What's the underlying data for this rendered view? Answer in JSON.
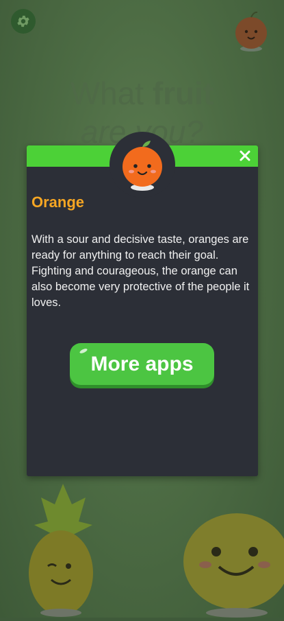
{
  "background": {
    "title_line1_normal": "What ",
    "title_line1_bold": "fruit",
    "title_line2": "are you?"
  },
  "icons": {
    "settings": "gear-icon",
    "close": "close-icon"
  },
  "modal": {
    "fruit_name": "Orange",
    "description": "With a sour and decisive taste, oranges are ready for anything to reach their goal. Fighting and courageous, the orange can also become very protective of the people it loves.",
    "button_label": "More apps"
  },
  "colors": {
    "accent_green": "#4cd137",
    "button_green": "#4cc542",
    "orange_title": "#f6a623",
    "modal_bg": "#2c2f37"
  }
}
